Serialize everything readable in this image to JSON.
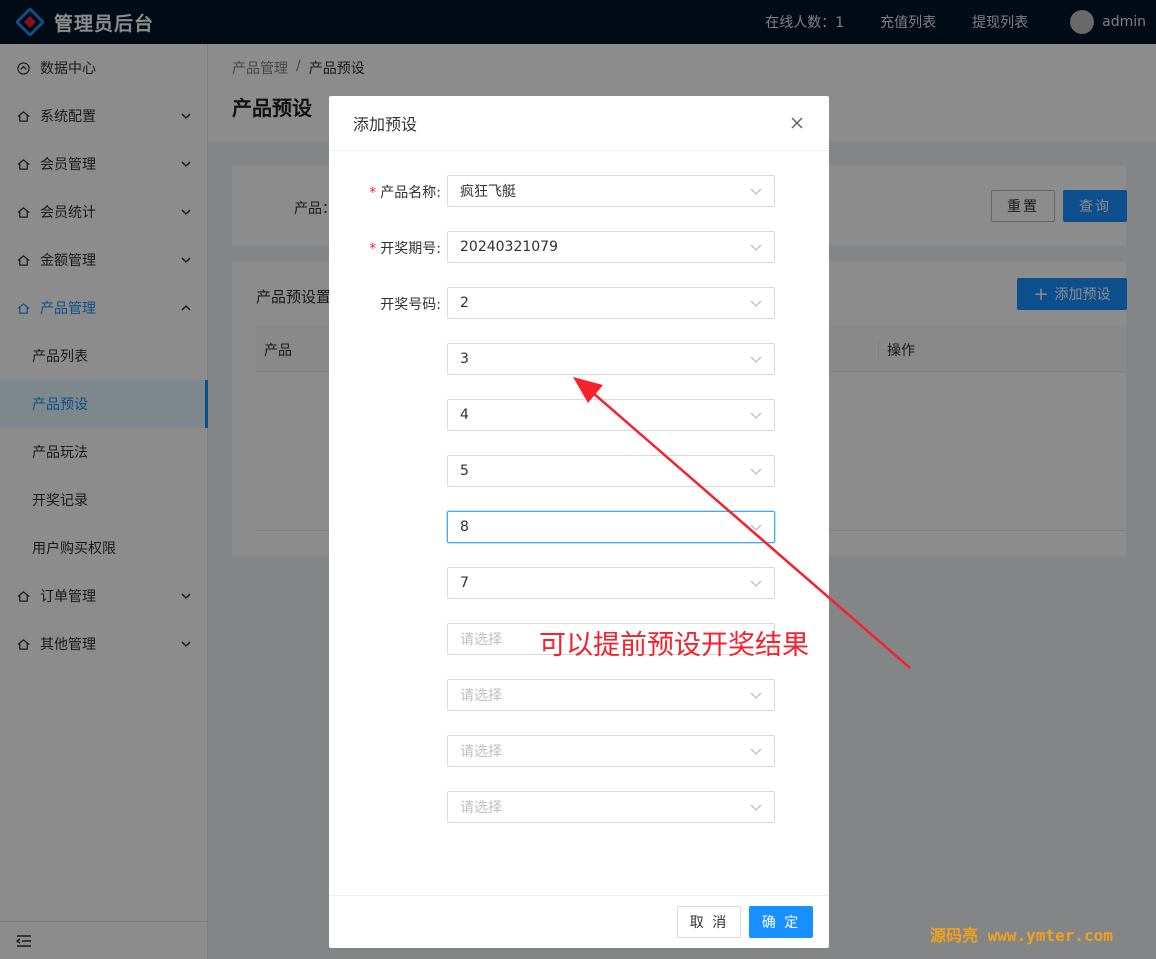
{
  "header": {
    "app_title": "管理员后台",
    "online_label": "在线人数：1",
    "recharge_link": "充值列表",
    "withdraw_link": "提现列表",
    "username": "admin"
  },
  "sidebar": {
    "items": [
      {
        "label": "数据中心",
        "icon": "dashboard-icon"
      },
      {
        "label": "系统配置",
        "icon": "home-icon"
      },
      {
        "label": "会员管理",
        "icon": "home-icon"
      },
      {
        "label": "会员统计",
        "icon": "home-icon"
      },
      {
        "label": "金额管理",
        "icon": "home-icon"
      },
      {
        "label": "产品管理",
        "icon": "home-icon"
      },
      {
        "label": "订单管理",
        "icon": "home-icon"
      },
      {
        "label": "其他管理",
        "icon": "home-icon"
      }
    ],
    "product_sub": [
      "产品列表",
      "产品预设",
      "产品玩法",
      "开奖记录",
      "用户购买权限"
    ]
  },
  "breadcrumb": {
    "parent": "产品管理",
    "sep": "/",
    "current": "产品预设"
  },
  "page_title": "产品预设",
  "search": {
    "label": "产品：",
    "reset": "重置",
    "query": "查询"
  },
  "table": {
    "title": "产品预设置",
    "add_button": "添加预设",
    "col_product": "产品",
    "col_ops": "操作"
  },
  "modal": {
    "title": "添加预设",
    "product_label": "产品名称:",
    "product_value": "疯狂飞艇",
    "issue_label": "开奖期号:",
    "issue_value": "20240321079",
    "numbers_label": "开奖号码:",
    "numbers": [
      "2",
      "3",
      "4",
      "5",
      "8",
      "7",
      "",
      "",
      "",
      ""
    ],
    "placeholder": "请选择",
    "cancel": "取 消",
    "confirm": "确 定"
  },
  "annotation": "可以提前预设开奖结果",
  "watermark": "源码亮 www.ymter.com",
  "colors": {
    "primary": "#1890ff",
    "header_bg": "#001529",
    "annotation": "#f5222d"
  }
}
